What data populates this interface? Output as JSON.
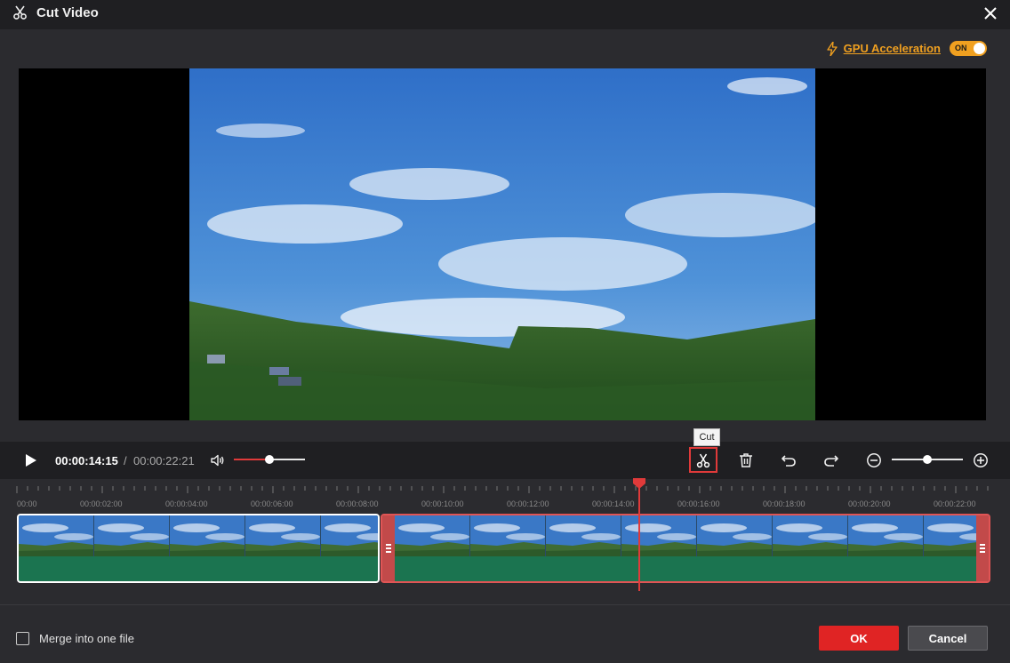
{
  "window": {
    "title": "Cut Video",
    "title_icon": "scissors-icon",
    "close_icon": "close-icon"
  },
  "gpu": {
    "label": "GPU Acceleration",
    "icon": "lightning-icon",
    "toggle_label": "ON",
    "enabled": true
  },
  "player": {
    "current_time": "00:00:14:15",
    "separator": "/",
    "total_time": "00:00:22:21",
    "volume_level": 0.5,
    "zoom_level": 0.5
  },
  "toolbar": {
    "cut_tooltip": "Cut",
    "tools": [
      "cut-icon",
      "delete-icon",
      "undo-icon",
      "redo-icon",
      "zoom-out-icon",
      "zoom-in-icon"
    ]
  },
  "timeline": {
    "ruler_labels": [
      "00:00",
      "00:00:02:00",
      "00:00:04:00",
      "00:00:06:00",
      "00:00:08:00",
      "00:00:10:00",
      "00:00:12:00",
      "00:00:14:00",
      "00:00:16:00",
      "00:00:18:00",
      "00:00:20:00",
      "00:00:22:00"
    ],
    "playhead_time": "00:00:14:15",
    "clips": [
      {
        "id": "clip-1",
        "selected": false
      },
      {
        "id": "clip-2",
        "selected": true
      }
    ]
  },
  "footer": {
    "merge_label": "Merge into one file",
    "merge_checked": false,
    "ok_label": "OK",
    "cancel_label": "Cancel"
  },
  "colors": {
    "accent": "#e02424",
    "gpu": "#f0a020",
    "clip_green": "#1b7450",
    "selected_border": "#e05555"
  }
}
